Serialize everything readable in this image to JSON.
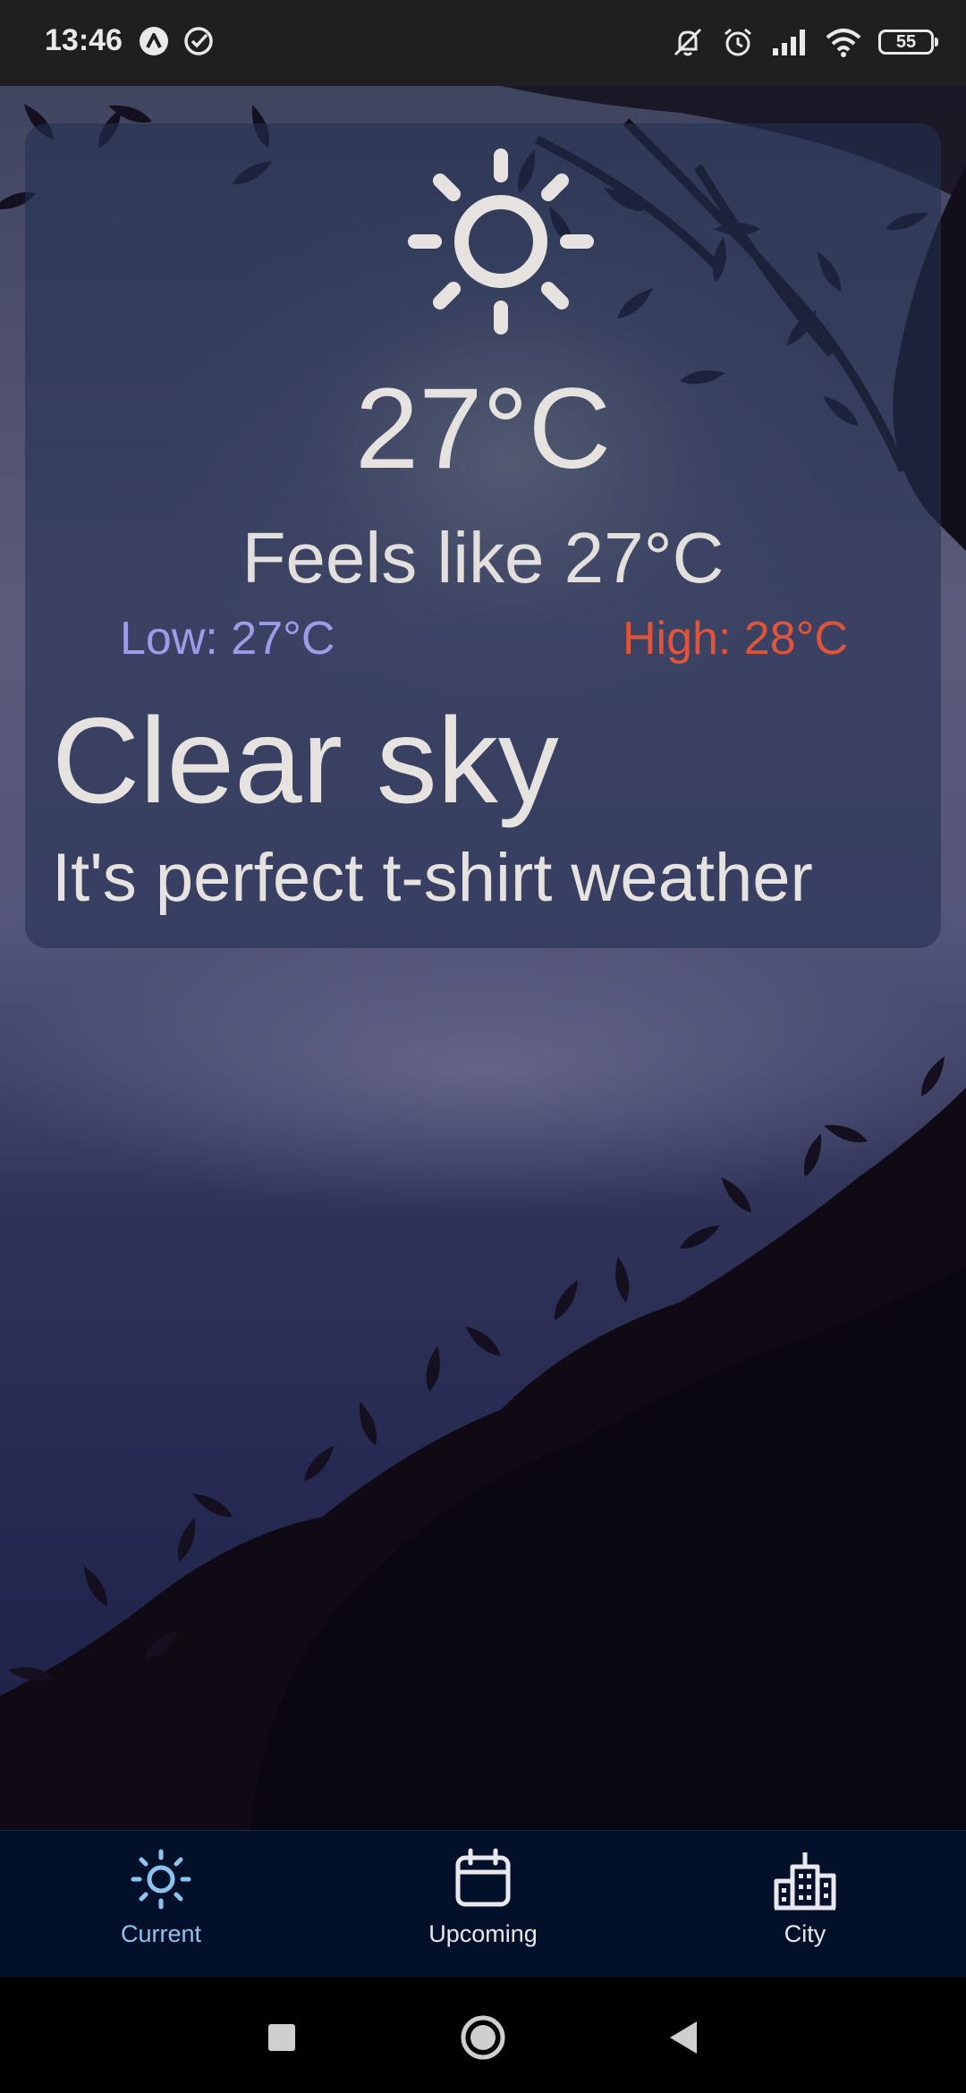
{
  "status_bar": {
    "time": "13:46",
    "battery": "55",
    "left_icons": [
      "app-a-icon",
      "check-circle-icon"
    ],
    "right_icons": [
      "bell-off-icon",
      "alarm-icon",
      "signal-icon",
      "wifi-icon",
      "battery-icon"
    ]
  },
  "weather": {
    "icon": "sun-icon",
    "temperature": "27°C",
    "feels_like": "Feels like 27°C",
    "low": "Low: 27°C",
    "high": "High: 28°C",
    "condition": "Clear sky",
    "advice": "It's perfect t-shirt weather",
    "colors": {
      "low": "#9d9ce8",
      "high": "#e0553a",
      "text": "#e6e2df"
    }
  },
  "bottom_nav": {
    "items": [
      {
        "label": "Current",
        "icon": "sun-icon",
        "active": true
      },
      {
        "label": "Upcoming",
        "icon": "calendar-icon",
        "active": false
      },
      {
        "label": "City",
        "icon": "city-buildings-icon",
        "active": false
      }
    ],
    "active_color": "#8cc4f0",
    "background": "#03102a"
  },
  "system_nav": {
    "buttons": [
      "recents-square-icon",
      "home-circle-icon",
      "back-triangle-icon"
    ]
  }
}
